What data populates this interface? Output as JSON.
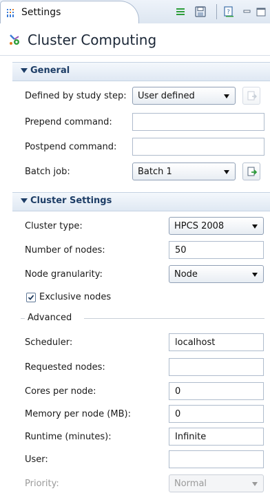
{
  "tab": {
    "title": "Settings",
    "icon": "settings-tab-icon"
  },
  "toolbar": [
    "menu-icon",
    "save-icon",
    "help-icon",
    "minimize-icon",
    "maximize-icon"
  ],
  "header": {
    "title": "Cluster Computing",
    "icon": "cluster-computing-icon"
  },
  "general": {
    "title": "General",
    "defined_by_label": "Defined by study step:",
    "defined_by_value": "User defined",
    "prepend_label": "Prepend command:",
    "prepend_value": "",
    "postpend_label": "Postpend command:",
    "postpend_value": "",
    "batch_label": "Batch job:",
    "batch_value": "Batch 1"
  },
  "cluster": {
    "title": "Cluster Settings",
    "type_label": "Cluster type:",
    "type_value": "HPCS 2008",
    "nodes_label": "Number of nodes:",
    "nodes_value": "50",
    "granularity_label": "Node granularity:",
    "granularity_value": "Node",
    "exclusive_label": "Exclusive nodes",
    "exclusive_checked": true,
    "advanced_title": "Advanced",
    "scheduler_label": "Scheduler:",
    "scheduler_value": "localhost",
    "requested_label": "Requested nodes:",
    "requested_value": "",
    "cores_label": "Cores per node:",
    "cores_value": "0",
    "memory_label": "Memory per node (MB):",
    "memory_value": "0",
    "runtime_label": "Runtime (minutes):",
    "runtime_value": "Infinite",
    "user_label": "User:",
    "user_value": "",
    "priority_label": "Priority:",
    "priority_value": "Normal"
  },
  "colors": {
    "section_text": "#1d3d66",
    "accent_green": "#2e9e3a",
    "header_text": "#1a2636"
  }
}
